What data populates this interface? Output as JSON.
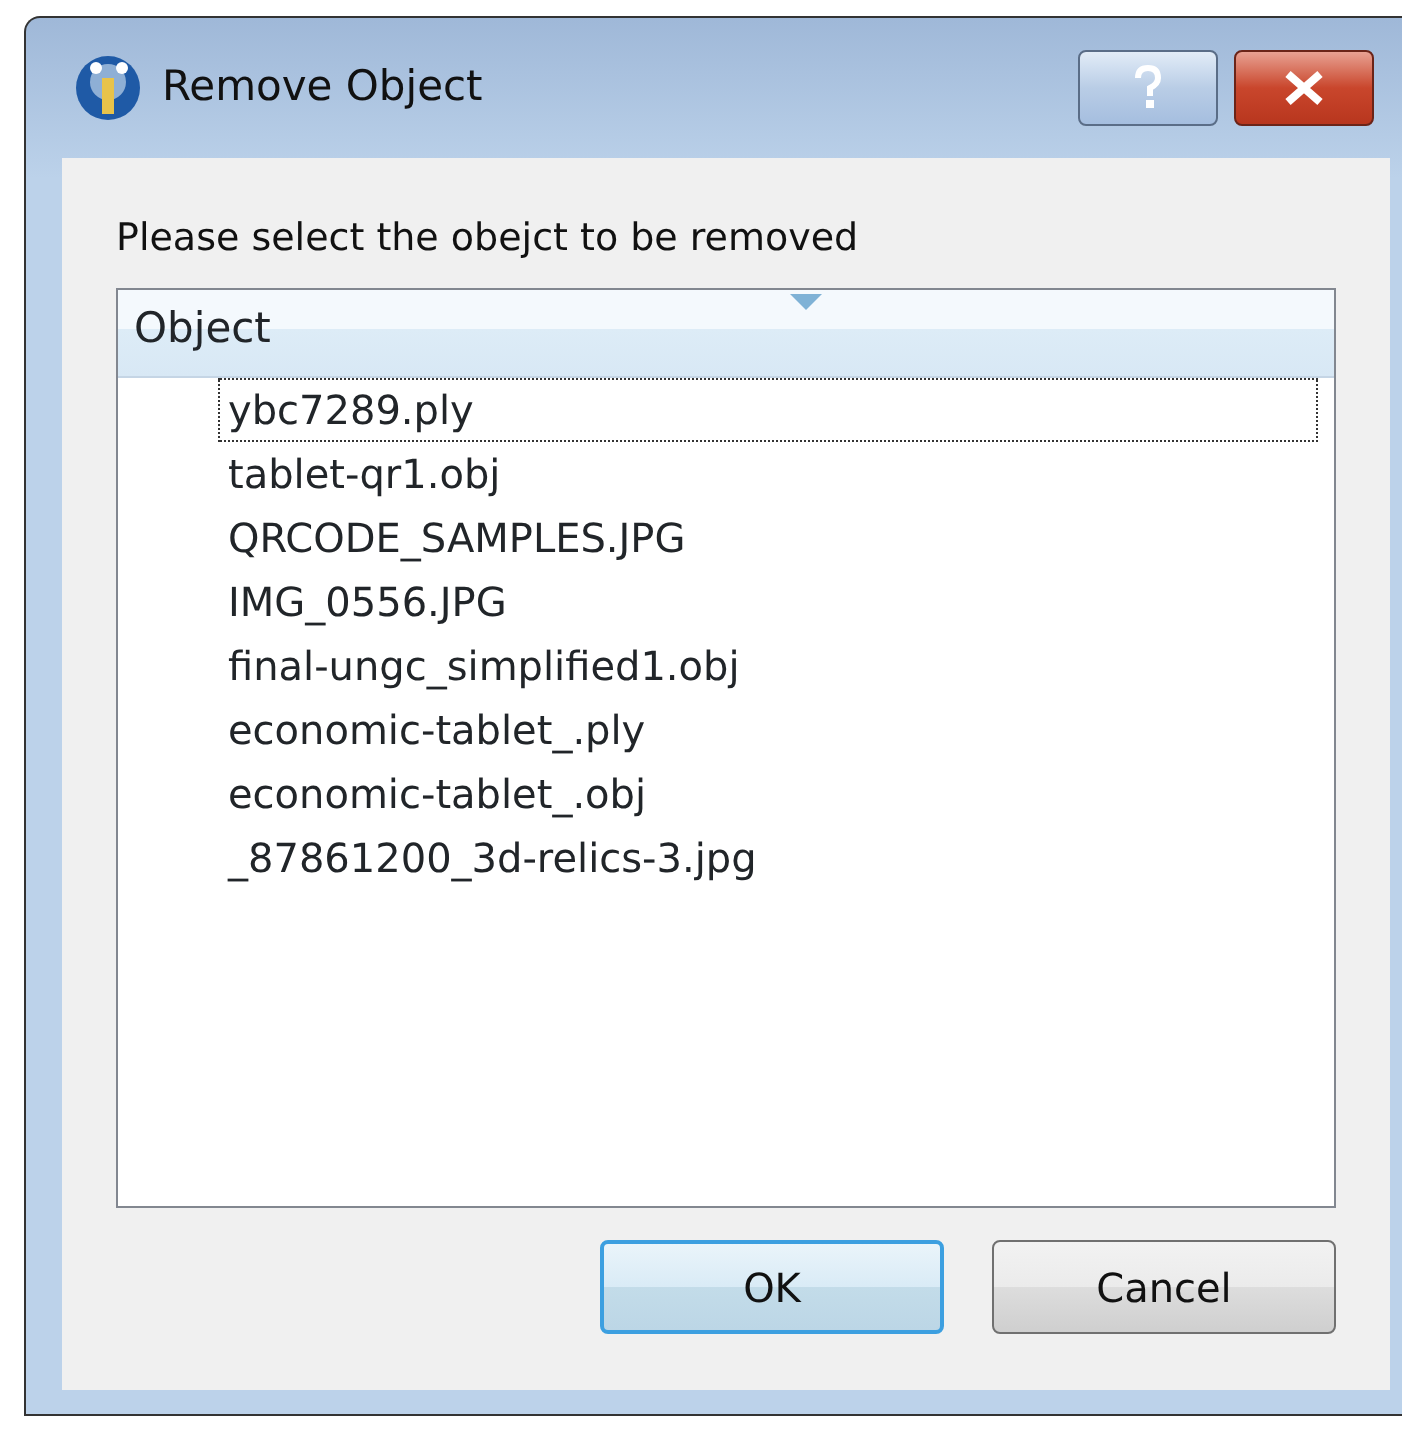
{
  "window": {
    "title": "Remove Object"
  },
  "prompt": "Please select the obejct to be removed",
  "list": {
    "column": "Object",
    "items": [
      {
        "label": "ybc7289.ply",
        "focused": true
      },
      {
        "label": "tablet-qr1.obj",
        "focused": false
      },
      {
        "label": "QRCODE_SAMPLES.JPG",
        "focused": false
      },
      {
        "label": "IMG_0556.JPG",
        "focused": false
      },
      {
        "label": "final-ungc_simplified1.obj",
        "focused": false
      },
      {
        "label": "economic-tablet_.ply",
        "focused": false
      },
      {
        "label": "economic-tablet_.obj",
        "focused": false
      },
      {
        "label": "_87861200_3d-relics-3.jpg",
        "focused": false
      }
    ]
  },
  "buttons": [
    {
      "label": "OK",
      "default": true
    },
    {
      "label": "Cancel",
      "default": false
    }
  ]
}
